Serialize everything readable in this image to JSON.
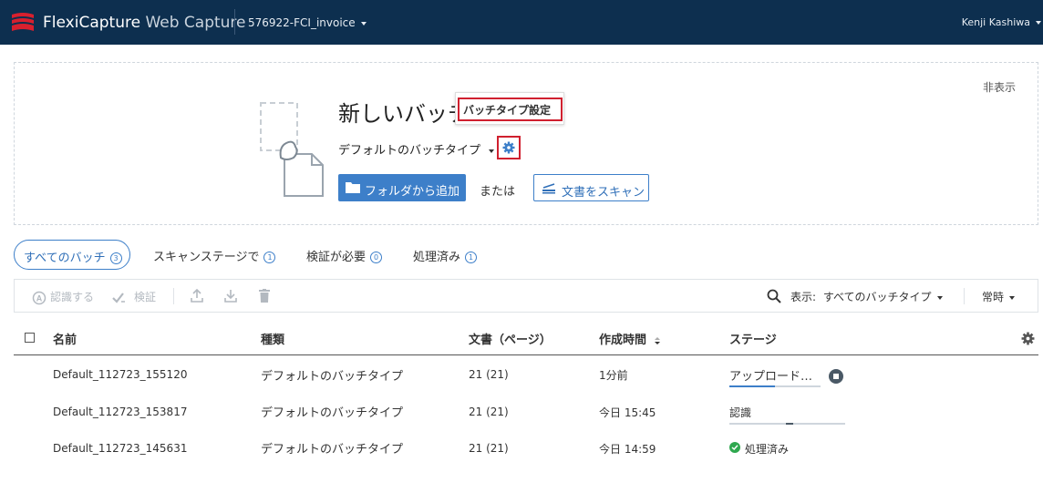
{
  "header": {
    "brand_main": "FlexiCapture",
    "brand_sub": " Web Capture",
    "project": "576922-FCI_invoice",
    "user": "Kenji Kashiwa"
  },
  "upload": {
    "hide_label": "非表示",
    "title": "新しいバッチ",
    "tooltip": "バッチタイプ設定",
    "batch_type": "デフォルトのバッチタイプ",
    "folder_button": "フォルダから追加",
    "or_text": "または",
    "scan_button": "文書をスキャン"
  },
  "tabs": [
    {
      "label": "すべてのバッチ",
      "count": "3"
    },
    {
      "label": "スキャンステージで",
      "count": "1"
    },
    {
      "label": "検証が必要",
      "count": "0"
    },
    {
      "label": "処理済み",
      "count": "1"
    }
  ],
  "toolbar": {
    "recognize": "認識する",
    "verify": "検証",
    "view_label": "表示:",
    "view_value": "すべてのバッチタイプ",
    "mode": "常時"
  },
  "table": {
    "columns": [
      "名前",
      "種類",
      "文書（ページ）",
      "作成時間",
      "ステージ"
    ],
    "rows": [
      {
        "name": "Default_112723_155120",
        "type": "デフォルトのバッチタイプ",
        "docs": "21 (21)",
        "created": "1分前",
        "stage": "アップロード…",
        "progress": 0.5
      },
      {
        "name": "Default_112723_153817",
        "type": "デフォルトのバッチタイプ",
        "docs": "21 (21)",
        "created": "今日 15:45",
        "stage": "認識",
        "progress": 0.75
      },
      {
        "name": "Default_112723_145631",
        "type": "デフォルトのバッチタイプ",
        "docs": "21 (21)",
        "created": "今日 14:59",
        "stage": "処理済み",
        "progress": 1.0
      }
    ]
  },
  "colors": {
    "accent": "#3d7fc9",
    "topbar": "#0d2f4f",
    "highlight": "#d0202f",
    "success": "#2fa84f"
  }
}
